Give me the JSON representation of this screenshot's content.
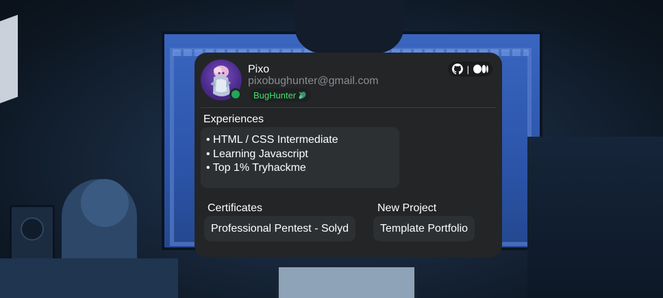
{
  "profile": {
    "name": "Pixo",
    "email": "pixobughunter@gmail.com",
    "badge": "BugHunter",
    "badge_icon": "bug-icon",
    "status": "online",
    "status_color": "#23a55a",
    "accent_color": "#3ee06a"
  },
  "socials": {
    "items": [
      "github-icon",
      "medium-icon"
    ],
    "separator": "|"
  },
  "experiences": {
    "title": "Experiences",
    "items": [
      "• HTML / CSS Intermediate",
      "• Learning Javascript",
      "• Top 1% Tryhackme"
    ]
  },
  "certificates": {
    "title": "Certificates",
    "items": [
      "Professional Pentest - Solyd"
    ]
  },
  "new_project": {
    "title": "New Project",
    "items": [
      "Template Portfolio"
    ]
  }
}
